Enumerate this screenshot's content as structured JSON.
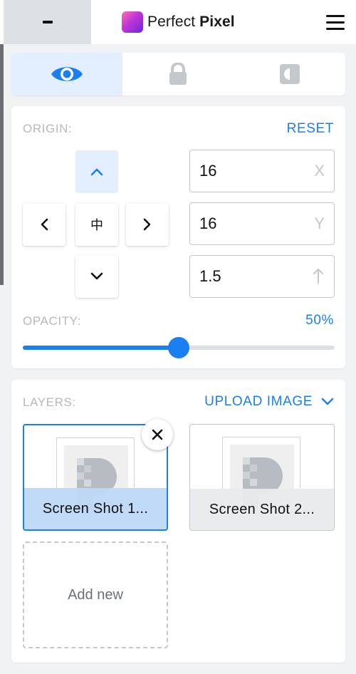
{
  "header": {
    "brand_regular": "Perfect ",
    "brand_bold": "Pixel",
    "collapse_icon": "minus-icon",
    "menu_icon": "hamburger-icon"
  },
  "tabs": [
    {
      "icon": "eye-icon",
      "active": true
    },
    {
      "icon": "lock-icon",
      "active": false
    },
    {
      "icon": "invert-icon",
      "active": false
    }
  ],
  "origin": {
    "label": "ORIGIN:",
    "reset_label": "RESET",
    "pad": {
      "up": "⌃",
      "left": "‹",
      "center": "中",
      "right": "›",
      "down": "⌄"
    },
    "x": {
      "value": "16",
      "suffix": "X"
    },
    "y": {
      "value": "16",
      "suffix": "Y"
    },
    "scale": {
      "value": "1.5",
      "suffix_icon": "arrow-up-icon"
    }
  },
  "opacity": {
    "label": "OPACITY:",
    "value_text": "50%",
    "value": 0.5
  },
  "layers": {
    "label": "LAYERS:",
    "upload_label": "UPLOAD IMAGE",
    "items": [
      {
        "caption": "Screen Shot 1...",
        "selected": true
      },
      {
        "caption": "Screen Shot 2...",
        "selected": false
      }
    ],
    "add_new_label": "Add new"
  },
  "colors": {
    "accent": "#1a7ff0",
    "active_tab_bg": "#e3efff",
    "muted_label": "#b6b9bd"
  }
}
